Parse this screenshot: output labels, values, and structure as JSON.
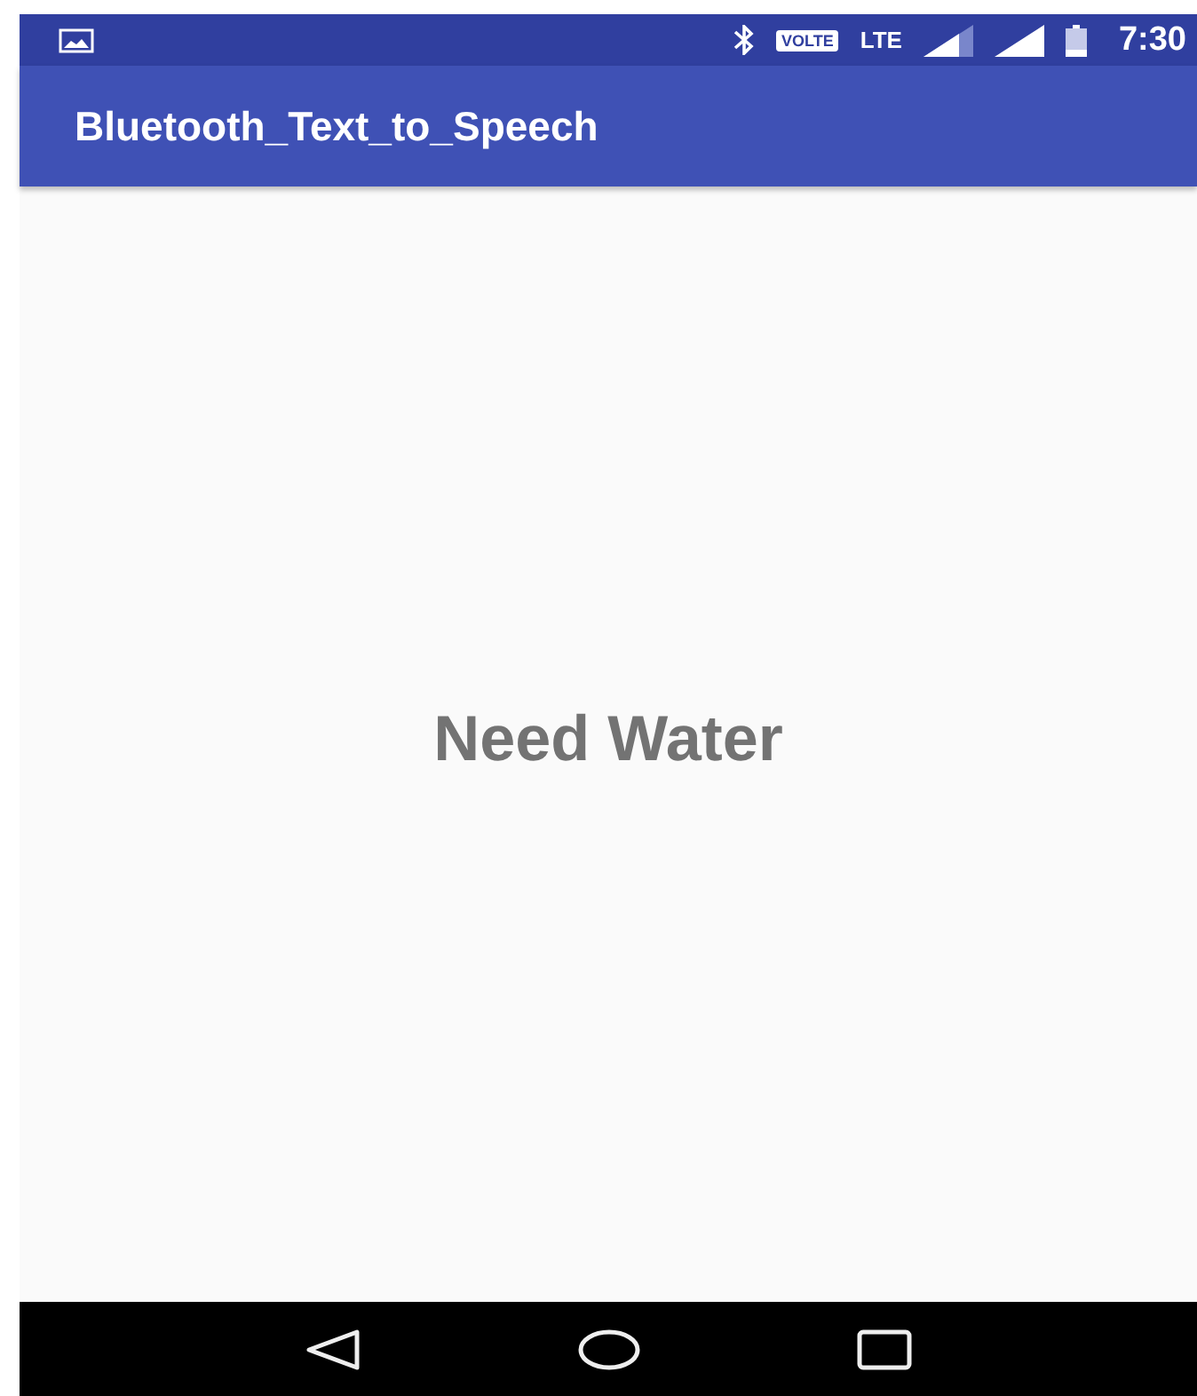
{
  "status_bar": {
    "volte": "VOLTE",
    "network": "LTE",
    "time": "7:30"
  },
  "app_bar": {
    "title": "Bluetooth_Text_to_Speech"
  },
  "content": {
    "message": "Need Water"
  }
}
